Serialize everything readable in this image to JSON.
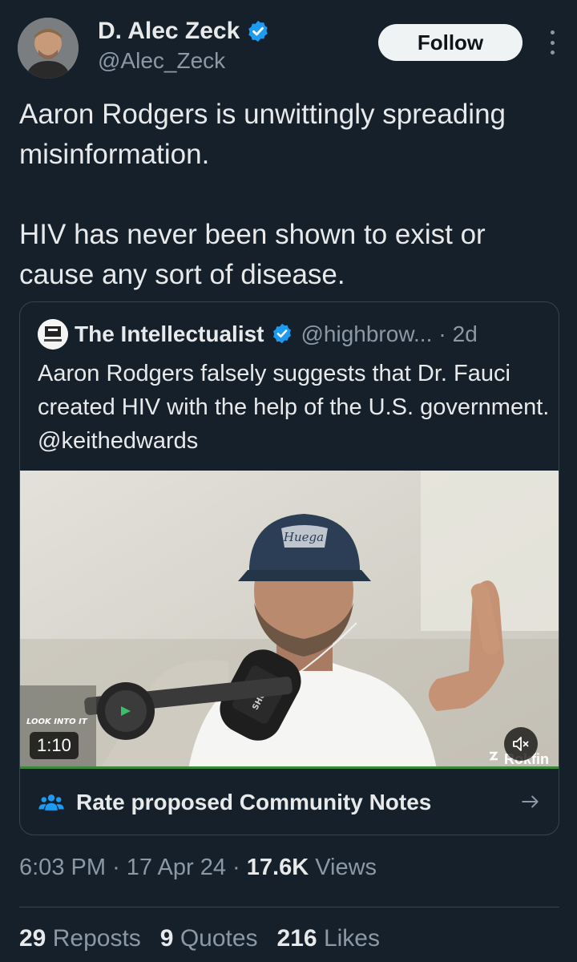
{
  "author": {
    "display_name": "D. Alec Zeck",
    "handle": "@Alec_Zeck",
    "verified": true
  },
  "follow_label": "Follow",
  "tweet": {
    "paragraphs": [
      "Aaron Rodgers is unwittingly spreading misinformation.",
      "HIV has never been shown to exist or cause any sort of disease."
    ]
  },
  "quote": {
    "display_name": "The Intellectualist",
    "handle": "@highbrow...",
    "separator": "·",
    "time": "2d",
    "text": "Aaron Rodgers falsely suggests that Dr. Fauci created HIV with the help of the U.S. government. @keithedwards",
    "video": {
      "duration": "1:10",
      "watermark": "Rokfin",
      "cap_text": "Huega",
      "mic_text": "SHURE",
      "overlay_text": "LOOK INTO IT"
    }
  },
  "community_notes": {
    "label": "Rate proposed Community Notes"
  },
  "meta": {
    "time": "6:03 PM",
    "sep1": "·",
    "date": "17 Apr 24",
    "sep2": "·",
    "views_count": "17.6K",
    "views_label": "Views"
  },
  "stats": {
    "reposts_count": "29",
    "reposts_label": "Reposts",
    "quotes_count": "9",
    "quotes_label": "Quotes",
    "likes_count": "216",
    "likes_label": "Likes"
  },
  "colors": {
    "background": "#15202b",
    "text": "#e7e9ea",
    "secondary": "#8b98a5",
    "verified": "#1d9bf0",
    "follow_bg": "#eff3f4"
  }
}
